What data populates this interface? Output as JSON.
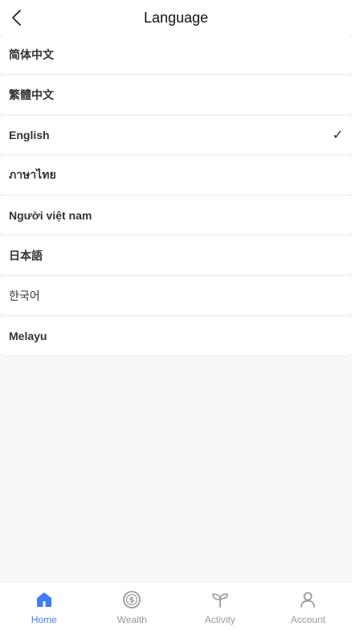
{
  "header": {
    "title": "Language",
    "back_icon": "chevron-left-icon"
  },
  "languages": [
    {
      "label": "简体中文",
      "selected": false
    },
    {
      "label": "繁體中文",
      "selected": false
    },
    {
      "label": "English",
      "selected": true
    },
    {
      "label": "ภาษาไทย",
      "selected": false
    },
    {
      "label": "Người việt nam",
      "selected": false
    },
    {
      "label": "日本語",
      "selected": false
    },
    {
      "label": "한국어",
      "selected": false
    },
    {
      "label": "Melayu",
      "selected": false
    }
  ],
  "check_mark": "✓",
  "tabbar": {
    "tabs": [
      {
        "label": "Home",
        "icon": "home-icon",
        "active": true
      },
      {
        "label": "Wealth",
        "icon": "dollar-coin-icon",
        "active": false
      },
      {
        "label": "Activity",
        "icon": "sprout-icon",
        "active": false
      },
      {
        "label": "Account",
        "icon": "user-icon",
        "active": false
      }
    ]
  },
  "colors": {
    "accent": "#3f7cf5",
    "inactive": "#9a9a9a",
    "background": "#f8f8f8"
  }
}
